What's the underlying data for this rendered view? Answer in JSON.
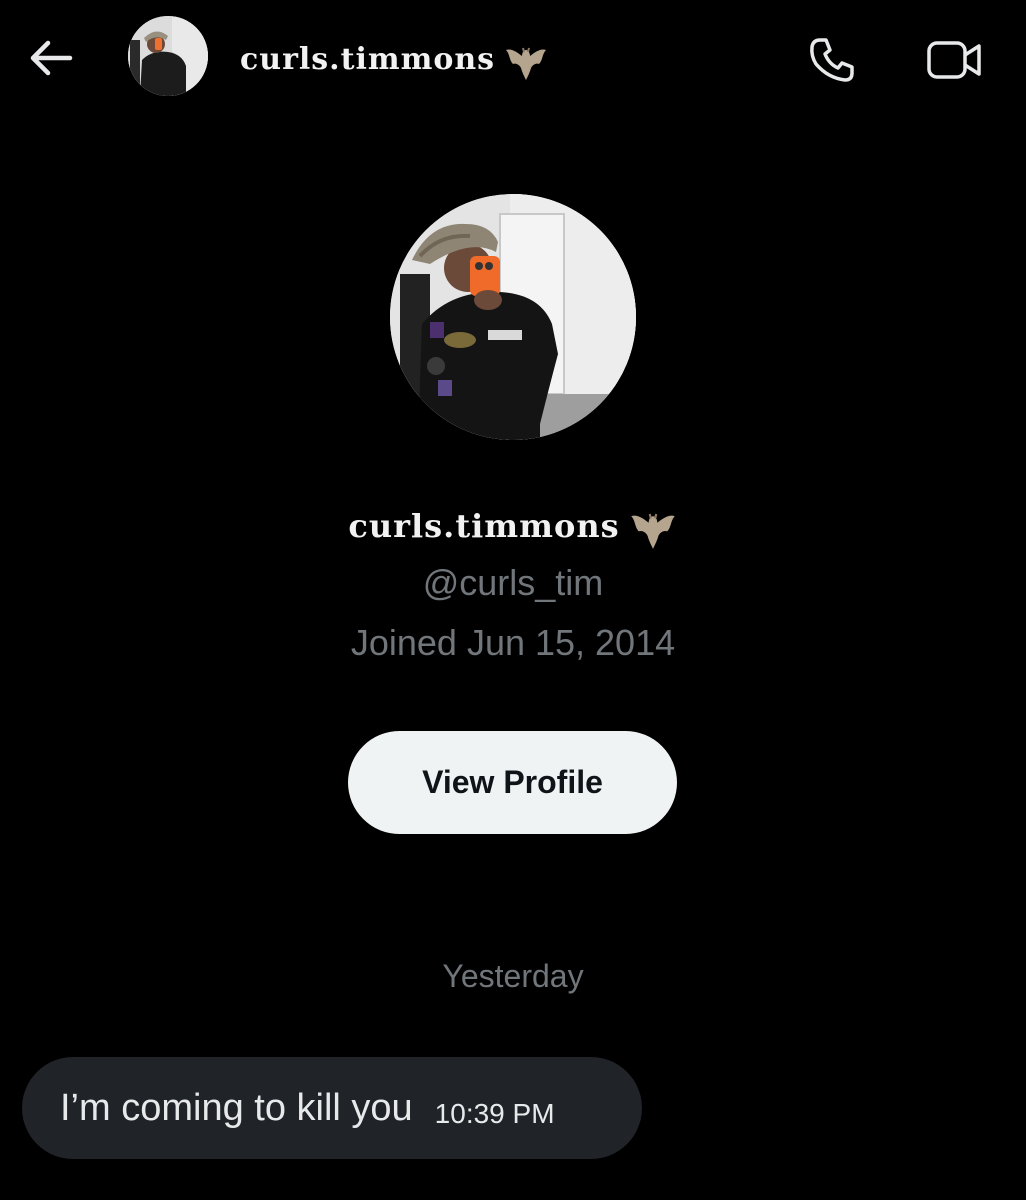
{
  "header": {
    "display_name": "curls.timmons",
    "name_emoji": "bat-icon"
  },
  "profile": {
    "display_name": "curls.timmons",
    "handle": "@curls_tim",
    "joined": "Joined Jun 15, 2014",
    "view_profile_label": "View Profile"
  },
  "conversation": {
    "date_separator": "Yesterday",
    "messages": [
      {
        "text": "I’m coming to kill you",
        "time": "10:39 PM",
        "direction": "received"
      }
    ]
  },
  "icons": {
    "back": "arrow-left-icon",
    "call": "phone-icon",
    "video": "video-camera-icon"
  },
  "colors": {
    "background": "#000000",
    "secondary_text": "#71767b",
    "button_bg": "#eff3f4",
    "bubble_bg": "#202327"
  }
}
